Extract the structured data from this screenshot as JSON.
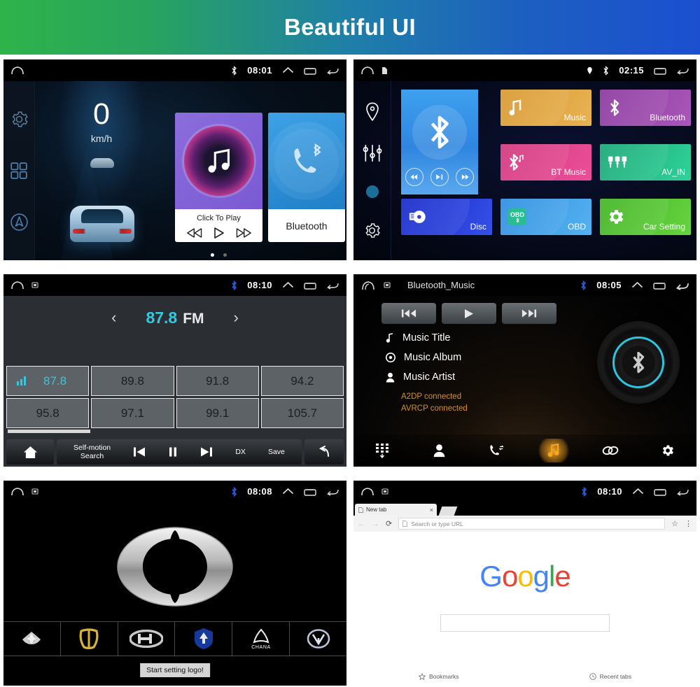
{
  "banner": {
    "title": "Beautiful UI"
  },
  "screens": {
    "home": {
      "status": {
        "time": "08:01",
        "icons": [
          "home-icon",
          "bluetooth-icon",
          "chevron-up-icon",
          "recents-icon",
          "back-icon"
        ]
      },
      "rail": [
        {
          "name": "settings",
          "icon": "gear-icon"
        },
        {
          "name": "apps",
          "icon": "apps-grid-icon"
        },
        {
          "name": "navigation",
          "icon": "navigation-arrow-icon"
        }
      ],
      "speed": {
        "value": "0",
        "unit": "km/h"
      },
      "music_widget": {
        "label": "Click To Play",
        "prev": "⏮",
        "play": "▷",
        "next": "⏭"
      },
      "bluetooth_widget": {
        "label": "Bluetooth"
      },
      "page_dots": 2
    },
    "apps": {
      "status": {
        "time": "02:15",
        "icons": [
          "home-icon",
          "sd-card-icon",
          "location-icon",
          "bluetooth-icon",
          "recents-icon",
          "back-icon"
        ]
      },
      "rail": [
        {
          "name": "navigation",
          "icon": "location-pin-icon"
        },
        {
          "name": "equalizer",
          "icon": "equalizer-icon"
        },
        {
          "name": "page-indicator",
          "icon": "dot-icon"
        },
        {
          "name": "settings",
          "icon": "gear-icon"
        }
      ],
      "big_tile": {
        "label": "Bluetooth",
        "icon": "bluetooth-icon",
        "controls": [
          "«",
          "▶❘",
          "»"
        ]
      },
      "tiles": [
        {
          "label": "Music",
          "icon": "music-note-icon",
          "color": "#e0a13a"
        },
        {
          "label": "Bluetooth",
          "icon": "bluetooth-icon",
          "color": "#9b3fa8"
        },
        {
          "label": "BT Music",
          "icon": "bt-music-icon",
          "color": "#e0458f"
        },
        {
          "label": "AV_IN",
          "icon": "av-jack-icon",
          "color": "#21bb82"
        },
        {
          "label": "Disc",
          "icon": "disc-icon",
          "color": "#2233cc"
        },
        {
          "label": "OBD",
          "icon": "obd-icon",
          "color": "#3b9ae8"
        },
        {
          "label": "Car Setting",
          "icon": "gear-icon",
          "color": "#4fc22e"
        }
      ]
    },
    "radio": {
      "status": {
        "time": "08:10"
      },
      "frequency": "87.8",
      "band": "FM",
      "prev_arrow": "‹",
      "next_arrow": "›",
      "presets": [
        "87.8",
        "89.8",
        "91.8",
        "94.2",
        "95.8",
        "97.1",
        "99.1",
        "105.7"
      ],
      "active_preset": "87.8",
      "toolbar": {
        "home": "home-icon",
        "search_label": "Self-motion\nSearch",
        "search_label_line1": "Self-motion",
        "search_label_line2": "Search",
        "prev": "⏮",
        "pause": "❘❘",
        "next": "⏭",
        "dx": "DX",
        "save": "Save",
        "back": "back-icon"
      }
    },
    "bt_music": {
      "status": {
        "time": "08:05",
        "title": "Bluetooth_Music"
      },
      "transport": {
        "prev": "⏮",
        "play": "▶",
        "next": "⏭"
      },
      "meta": [
        {
          "icon": "note-icon",
          "text": "Music Title"
        },
        {
          "icon": "album-icon",
          "text": "Music Album"
        },
        {
          "icon": "person-icon",
          "text": "Music Artist"
        }
      ],
      "connections": [
        "A2DP connected",
        "AVRCP connected"
      ],
      "nav": [
        {
          "name": "dialpad",
          "icon": "dialpad-icon",
          "active": false
        },
        {
          "name": "contacts",
          "icon": "person-icon",
          "active": false
        },
        {
          "name": "calls",
          "icon": "call-history-icon",
          "active": false
        },
        {
          "name": "music",
          "icon": "music-note-icon",
          "active": true
        },
        {
          "name": "pair",
          "icon": "link-icon",
          "active": false
        },
        {
          "name": "settings",
          "icon": "gear-icon",
          "active": false
        }
      ]
    },
    "logo": {
      "status": {
        "time": "08:08"
      },
      "selected_brand": "baic-logo",
      "brands": [
        "maxus-logo",
        "baojun-logo",
        "haval-logo",
        "dongfeng-logo",
        "chana-logo",
        "changan-logo"
      ],
      "brand_labels": [
        "",
        "",
        "",
        "",
        "CHANA",
        ""
      ],
      "toast": "Start setting logo!"
    },
    "browser": {
      "status": {
        "time": "08:10"
      },
      "tab": {
        "title": "New tab",
        "close": "×"
      },
      "toolbar": {
        "back": "←",
        "forward": "→",
        "reload": "⟳",
        "star": "☆",
        "menu": "⋮"
      },
      "url_placeholder": "Search or type URL",
      "logo_letters": [
        {
          "ch": "G",
          "color": "#4285f4"
        },
        {
          "ch": "o",
          "color": "#ea4335"
        },
        {
          "ch": "o",
          "color": "#fbbc05"
        },
        {
          "ch": "g",
          "color": "#4285f4"
        },
        {
          "ch": "l",
          "color": "#34a853"
        },
        {
          "ch": "e",
          "color": "#ea4335"
        }
      ],
      "footer": [
        {
          "icon": "star-icon",
          "label": "Bookmarks"
        },
        {
          "icon": "clock-icon",
          "label": "Recent tabs"
        }
      ]
    }
  },
  "colors": {
    "accent_cyan": "#35c8e0",
    "accent_orange": "#d2912f",
    "banner_from": "#2eb34a",
    "banner_to": "#1b4fd0"
  }
}
